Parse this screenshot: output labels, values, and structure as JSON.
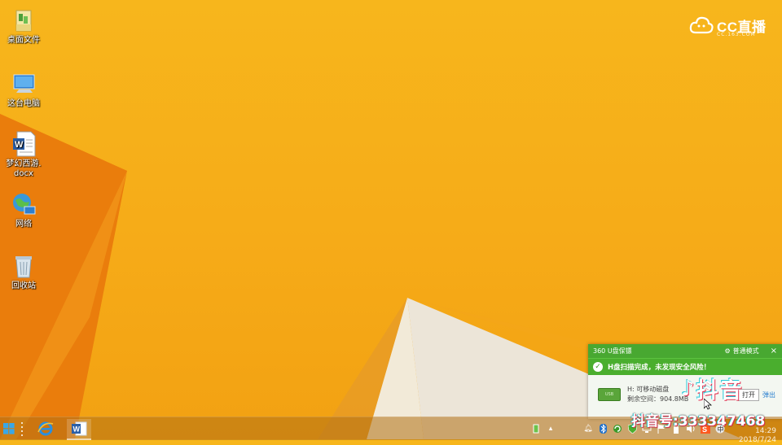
{
  "desktop": {
    "icons": [
      {
        "label": "桌面文件",
        "icon": "folder-icon"
      },
      {
        "label": "这台电脑",
        "icon": "computer-icon"
      },
      {
        "label": "梦幻西游.",
        "label2": "docx",
        "icon": "word-document-icon"
      },
      {
        "label": "网络",
        "icon": "network-icon"
      },
      {
        "label": "回收站",
        "icon": "recycle-bin-icon"
      }
    ]
  },
  "cc_logo": {
    "text": "CC直播",
    "sub": "CC.163.COM"
  },
  "popup_360": {
    "title": "360 U盘保镖",
    "mode": "普通模式",
    "close": "×",
    "banner": "H盘扫描完成，未发现安全风险！",
    "drive_name": "H: 可移动磁盘",
    "free_space": "剩余空间：904.8MB",
    "open_button": "打开",
    "eject_button": "弹出"
  },
  "watermark": {
    "app": "抖音",
    "id_text": "抖音号:333347468"
  },
  "taskbar": {
    "pinned": [
      "windows-start-icon",
      "internet-explorer-icon",
      "word-icon"
    ],
    "tray": [
      "battery-icon",
      "triangle-icon",
      "bell-icon",
      "bluetooth-icon",
      "refresh-icon",
      "shield-icon",
      "network-icon",
      "flag-icon",
      "usb-icon",
      "volume-icon",
      "ime-icon",
      "sogou-icon"
    ],
    "time": "14:29",
    "date": "2018/7/24"
  },
  "colors": {
    "wallpaper": "#f6ab18",
    "accent_green": "#48a831",
    "taskbar": "#b07014"
  }
}
